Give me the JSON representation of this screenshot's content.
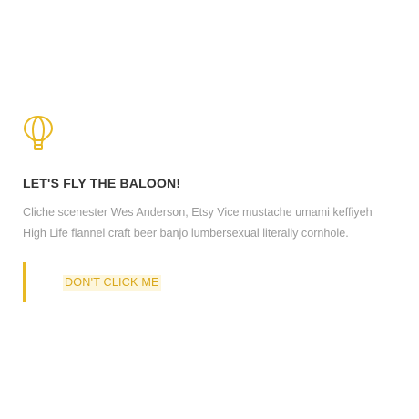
{
  "card": {
    "icon": "hot-air-balloon-icon",
    "title": "LET'S FLY THE BALOON!",
    "description_lines": [
      "Cliche scenester Wes Anderson, Etsy Vice mustache umami keffiyeh",
      "High Life flannel craft beer banjo lumbersexual literally cornhole."
    ],
    "cta_label": "DON'T CLICK ME"
  },
  "colors": {
    "accent": "#e8b923",
    "title": "#333333",
    "text": "#9a9a9a",
    "cta_text": "#d9a71a",
    "cta_highlight": "#fdf6dc"
  }
}
